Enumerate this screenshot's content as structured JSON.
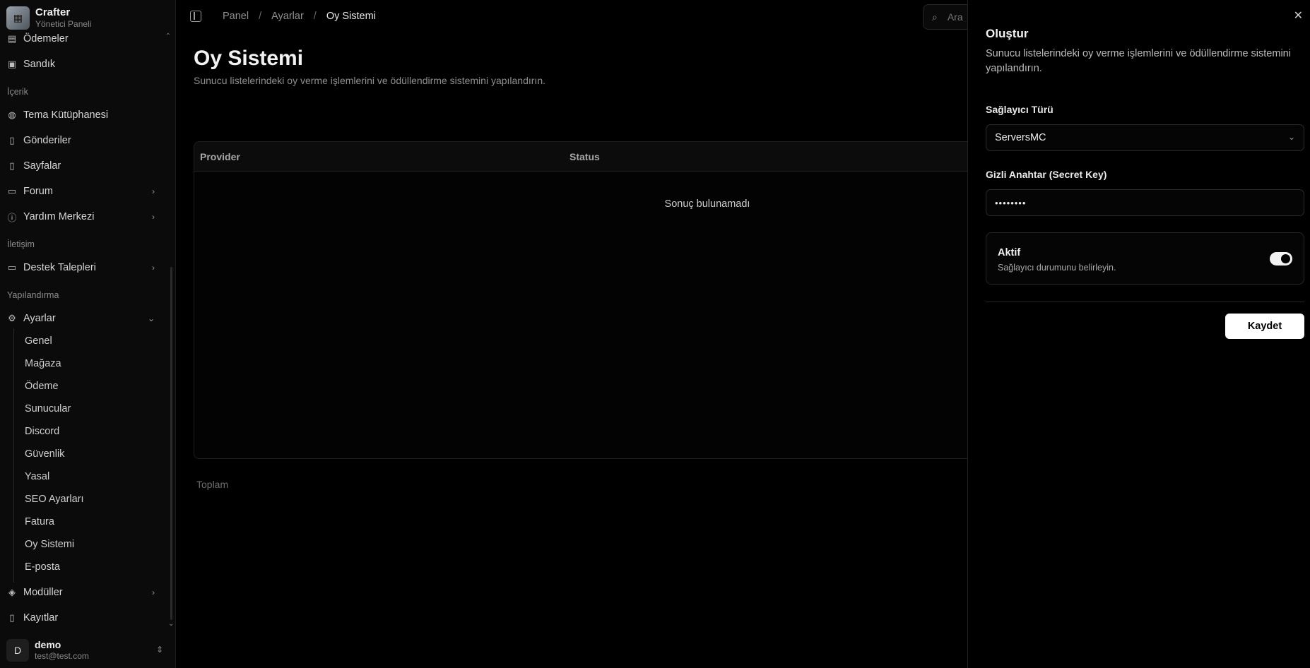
{
  "brand": {
    "name": "Crafter",
    "subtitle": "Yönetici Paneli"
  },
  "sidebar": {
    "top_items": [
      {
        "label": "Ödemeler",
        "icon": "receipt-icon"
      },
      {
        "label": "Sandık",
        "icon": "image-icon"
      }
    ],
    "sections": [
      {
        "title": "İçerik"
      },
      {
        "title": "İletişim"
      },
      {
        "title": "Yapılandırma"
      }
    ],
    "content_items": [
      {
        "label": "Tema Kütüphanesi",
        "icon": "palette-icon"
      },
      {
        "label": "Gönderiler",
        "icon": "file-icon"
      },
      {
        "label": "Sayfalar",
        "icon": "file-icon"
      },
      {
        "label": "Forum",
        "icon": "message-square-icon"
      },
      {
        "label": "Yardım Merkezi",
        "icon": "info-icon"
      }
    ],
    "contact_items": [
      {
        "label": "Destek Talepleri",
        "icon": "message-square-icon"
      }
    ],
    "settings": {
      "label": "Ayarlar",
      "icon": "gear-icon"
    },
    "settings_children": [
      "Genel",
      "Mağaza",
      "Ödeme",
      "Sunucular",
      "Discord",
      "Güvenlik",
      "Yasal",
      "SEO Ayarları",
      "Fatura",
      "Oy Sistemi",
      "E-posta"
    ],
    "bottom_items": [
      {
        "label": "Modüller",
        "icon": "layers-icon"
      },
      {
        "label": "Kayıtlar",
        "icon": "file-icon"
      }
    ]
  },
  "user": {
    "initial": "D",
    "name": "demo",
    "email": "test@test.com"
  },
  "breadcrumb": {
    "items": [
      "Panel",
      "Ayarlar",
      "Oy Sistemi"
    ]
  },
  "search": {
    "placeholder": "Ara"
  },
  "page": {
    "title": "Oy Sistemi",
    "description": "Sunucu listelerindeki oy verme işlemlerini ve ödüllendirme sistemini yapılandırın."
  },
  "table": {
    "columns": [
      "Provider",
      "Status"
    ],
    "empty_text": "Sonuç bulunamadı",
    "footer": "Toplam"
  },
  "drawer": {
    "title": "Oluştur",
    "description": "Sunucu listelerindeki oy verme işlemlerini ve ödüllendirme sistemini yapılandırın.",
    "provider_label": "Sağlayıcı Türü",
    "provider_value": "ServersMC",
    "secret_label": "Gizli Anahtar (Secret Key)",
    "secret_value": "••••••••",
    "active_title": "Aktif",
    "active_desc": "Sağlayıcı durumunu belirleyin.",
    "active_state": true,
    "save_label": "Kaydet"
  }
}
